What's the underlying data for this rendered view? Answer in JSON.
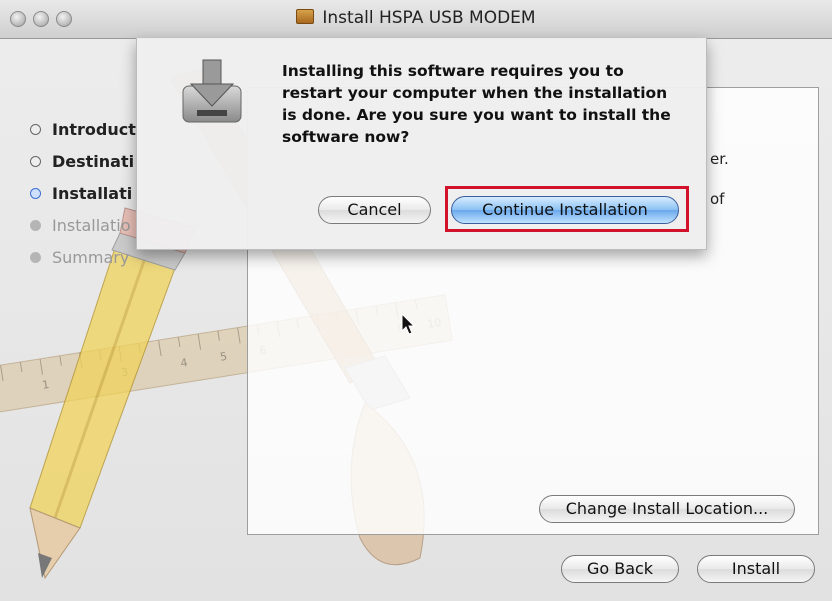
{
  "window": {
    "title": "Install HSPA USB MODEM",
    "close_icon": "close-button",
    "minimize_icon": "minimize-button",
    "zoom_icon": "zoom-button"
  },
  "sidebar": {
    "steps": [
      {
        "label": "Introduct",
        "state": "done"
      },
      {
        "label": "Destinati",
        "state": "done"
      },
      {
        "label": "Installati",
        "state": "current"
      },
      {
        "label": "Installatio",
        "state": "future"
      },
      {
        "label": "Summary",
        "state": "future"
      }
    ]
  },
  "panel": {
    "text_line1_visible": "er.",
    "text_line2_visible": "of",
    "change_location_label": "Change Install Location..."
  },
  "footer": {
    "back_label": "Go Back",
    "install_label": "Install"
  },
  "sheet": {
    "message": "Installing this software requires you to restart your computer when the installation is done. Are you sure you want to install the software now?",
    "cancel_label": "Cancel",
    "continue_label": "Continue Installation",
    "icon": "disk-install-icon"
  }
}
